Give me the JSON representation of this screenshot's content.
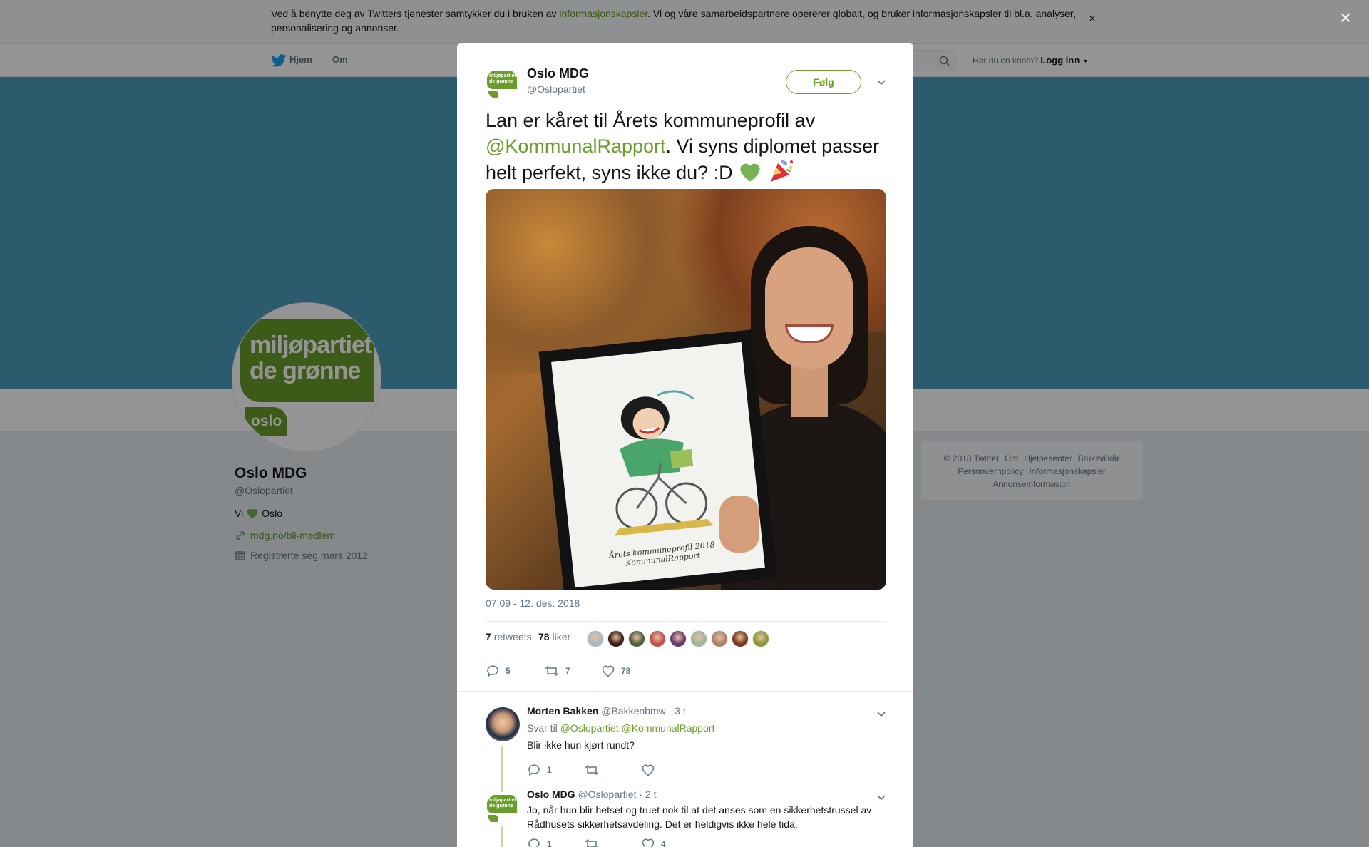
{
  "cookie_bar": {
    "text_before": "Ved å benytte deg av Twitters tjenester samtykker du i bruken av ",
    "link": "informasjonskapsler",
    "text_after": ". Vi og våre samarbeidspartnere opererer globalt, og bruker informasjonskapsler til bl.a. analyser, personalisering og annonser.",
    "close": "×"
  },
  "nav": {
    "home": "Hjem",
    "about": "Om",
    "account_prompt": "Har du en konto?",
    "login": "Logg inn"
  },
  "profile": {
    "logo_line1": "miljøpartiet",
    "logo_line2": "de grønne",
    "logo_oslo": "oslo",
    "name": "Oslo MDG",
    "handle": "@Oslopartiet",
    "bio_before": "Vi",
    "bio_after": "Oslo",
    "url": "mdg.no/bli-medlem",
    "joined": "Registrerte seg mars 2012"
  },
  "footer": {
    "links": [
      "© 2018 Twitter",
      "Om",
      "Hjelpesenter",
      "Bruksvilkår",
      "Personvernpolicy",
      "Informasjonskapsler",
      "Annonseinformasjon"
    ]
  },
  "overlay_close": "×",
  "tweet": {
    "name": "Oslo MDG",
    "handle": "@Oslopartiet",
    "follow_label": "Følg",
    "logo_text": "miljøpartiet de grønne",
    "text_part1": "Lan er kåret til Årets kommuneprofil av",
    "mention": "@KommunalRapport",
    "text_part2": ". Vi syns diplomet passer helt perfekt, syns ikke du? :D",
    "photo_caption": "Årets kommuneprofil 2018 KommunalRapport",
    "timestamp": "07:09 - 12. des. 2018",
    "retweets_count": "7",
    "retweets_label": "retweets",
    "likes_count": "78",
    "likes_label": "liker",
    "actions": {
      "replies": "5",
      "retweets": "7",
      "likes": "78"
    },
    "liker_avatar_colors": [
      "#aab8c2",
      "#3b1f16",
      "#4f5f3b",
      "#c0504d",
      "#6b3a6b",
      "#9fb59a",
      "#b07f6a",
      "#7a3a1c",
      "#8a9a3a"
    ]
  },
  "replies": [
    {
      "name": "Morten Bakken",
      "handle": "@Bakkenbmw",
      "time": "· 3 t",
      "reply_to_label": "Svar til",
      "reply_to_1": "@Oslopartiet",
      "reply_to_2": "@KommunalRapport",
      "text": "Blir ikke hun kjørt rundt?",
      "reply_count": "1",
      "retweet_count": "",
      "like_count": ""
    },
    {
      "name": "Oslo MDG",
      "handle": "@Oslopartiet",
      "time": "· 2 t",
      "text": "Jo, når hun blir hetset og truet nok til at det anses som en sikkerhetstrussel av Rådhusets sikkerhetsavdeling. Det er heldigvis ikke hele tida.",
      "reply_count": "1",
      "retweet_count": "",
      "like_count": "4"
    }
  ]
}
